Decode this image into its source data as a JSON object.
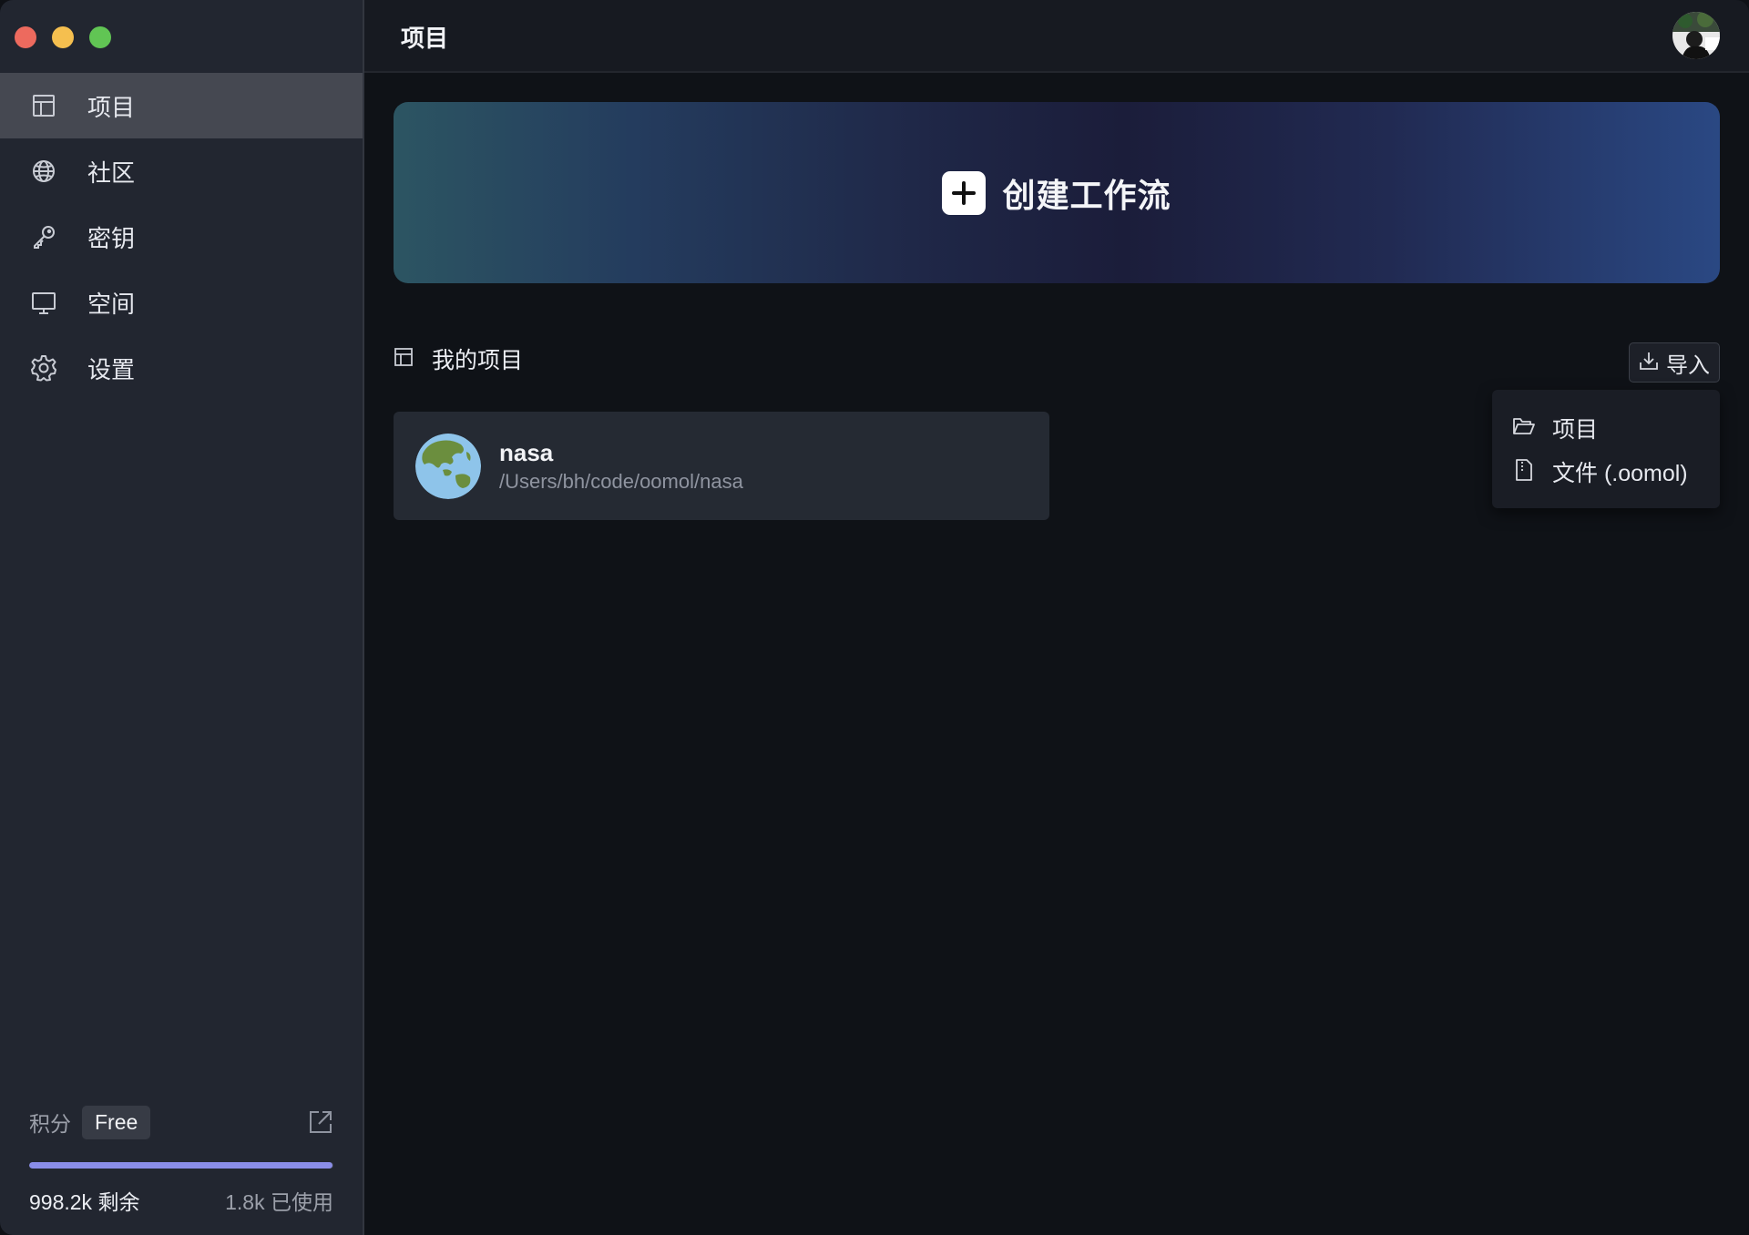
{
  "sidebar": {
    "items": [
      {
        "label": "项目",
        "icon": "grid-icon",
        "active": true
      },
      {
        "label": "社区",
        "icon": "globe-icon",
        "active": false
      },
      {
        "label": "密钥",
        "icon": "key-icon",
        "active": false
      },
      {
        "label": "空间",
        "icon": "monitor-icon",
        "active": false
      },
      {
        "label": "设置",
        "icon": "gear-icon",
        "active": false
      }
    ],
    "credits": {
      "label": "积分",
      "plan": "Free",
      "remaining": "998.2k 剩余",
      "used": "1.8k 已使用",
      "remaining_fraction": 0.998
    }
  },
  "header": {
    "title": "项目"
  },
  "banner": {
    "label": "创建工作流"
  },
  "section": {
    "title": "我的项目"
  },
  "import": {
    "label": "导入",
    "menu": [
      {
        "label": "项目",
        "icon": "folder-open-icon"
      },
      {
        "label": "文件 (.oomol)",
        "icon": "file-icon"
      }
    ]
  },
  "projects": [
    {
      "name": "nasa",
      "path": "/Users/bh/code/oomol/nasa",
      "icon": "earth-globe-icon"
    }
  ],
  "colors": {
    "sidebar_bg": "#222630",
    "main_bg": "#0f1217",
    "accent": "#8a8de8"
  }
}
